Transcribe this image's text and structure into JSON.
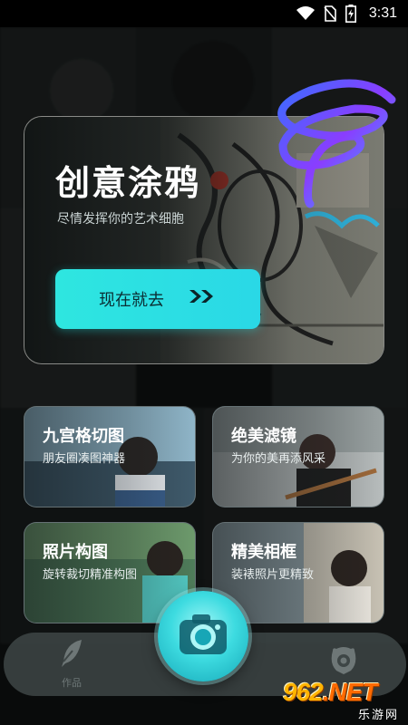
{
  "status_bar": {
    "time": "3:31",
    "icons": [
      "wifi-icon",
      "no-sim-icon",
      "battery-charging-icon"
    ]
  },
  "hero": {
    "title": "创意涂鸦",
    "subtitle": "尽情发挥你的艺术细胞",
    "button_label": "现在就去",
    "button_icon": "double-chevron-right-icon"
  },
  "cards": [
    {
      "title": "九宫格切图",
      "subtitle": "朋友圈凑图神器"
    },
    {
      "title": "绝美滤镜",
      "subtitle": "为你的美再添风采"
    },
    {
      "title": "照片构图",
      "subtitle": "旋转裁切精准构图"
    },
    {
      "title": "精美相框",
      "subtitle": "装裱照片更精致"
    }
  ],
  "bottom_nav": {
    "works_label": "作品",
    "works_icon": "feather-icon",
    "center_icon": "camera-icon",
    "profile_icon": "profile-icon"
  },
  "watermark": {
    "logo_main": "962",
    "logo_suffix": ".NET",
    "sub": "乐游网"
  },
  "colors": {
    "accent": "#2ee6e0",
    "background": "#0d0f0f",
    "nav_bg": "#3e4646"
  }
}
